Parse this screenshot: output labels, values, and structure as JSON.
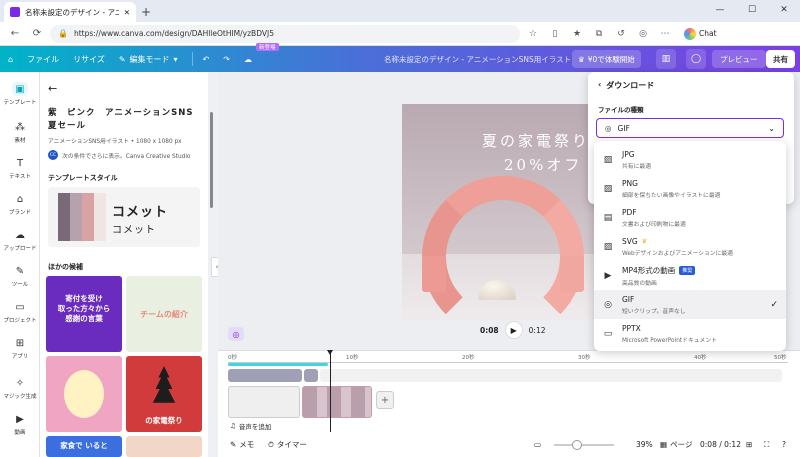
{
  "browser": {
    "tab_title": "名称未設定のデザイン - アニメーション",
    "url": "https://www.canva.com/design/DAHlleOtHIM/yzBDVJ5",
    "chat_label": "Chat"
  },
  "topbar": {
    "file": "ファイル",
    "resize": "リサイズ",
    "edit_mode": "編集モード",
    "new_badge": "新登場",
    "doc_title": "名称未設定のデザイン - アニメーションSNS用イラスト",
    "trial": "¥0で体験開始",
    "preview": "プレビュー",
    "share": "共有"
  },
  "rail": {
    "items": [
      {
        "label": "テンプレート"
      },
      {
        "label": "素材"
      },
      {
        "label": "テキスト"
      },
      {
        "label": "ブランド"
      },
      {
        "label": "アップロード"
      },
      {
        "label": "ツール"
      },
      {
        "label": "プロジェクト"
      },
      {
        "label": "アプリ"
      },
      {
        "label": "マジック生成"
      },
      {
        "label": "動画"
      }
    ]
  },
  "panel": {
    "title": "紫　ピンク　アニメーションSNS　夏セール",
    "meta": "アニメーションSNS用イラスト • 1080 x 1080 px",
    "author_initials": "CC",
    "author_line": "次の条件でさらに表示。Canva Creative Studio",
    "style_heading": "テンプレートスタイル",
    "font_sample_1": "コメット",
    "font_sample_2": "コメット",
    "swatch_colors": [
      "#7a6a78",
      "#b5a2ad",
      "#d9a3a3",
      "#efe5e3"
    ],
    "other_heading": "ほかの候補",
    "thumbs": [
      {
        "text": "寄付を受け\n取った方々から\n感謝の言葉"
      },
      {
        "text": "チームの紹介"
      },
      {
        "text": ""
      },
      {
        "text": "の家電祭り"
      },
      {
        "text": "家食で いると"
      }
    ]
  },
  "canvas": {
    "art_line1": "夏の家電祭り",
    "art_line2": "20%オフ",
    "current_time": "0:08",
    "total_time": "0:12"
  },
  "timeline": {
    "ticks": [
      "0秒",
      "10秒",
      "20秒",
      "30秒",
      "40秒",
      "50秒"
    ],
    "add_audio": "音声を追加"
  },
  "bottombar": {
    "memo": "メモ",
    "timer": "タイマー",
    "zoom": "39%",
    "page": "ページ",
    "time": "0:08 / 0:12"
  },
  "download": {
    "heading": "ダウンロード",
    "file_type_label": "ファイルの種類",
    "selected": "GIF",
    "options": [
      {
        "name": "JPG",
        "desc": "共有に最適",
        "icon": "image-icon"
      },
      {
        "name": "PNG",
        "desc": "細部を保ちたい画像やイラストに最適",
        "icon": "image-icon"
      },
      {
        "name": "PDF",
        "desc": "文書および印刷物に最適",
        "icon": "document-icon"
      },
      {
        "name": "SVG",
        "desc": "Webデザインおよびアニメーションに最適",
        "icon": "image-icon"
      },
      {
        "name": "MP4形式の動画",
        "badge": "推奨",
        "desc": "高品質の動画",
        "icon": "video-icon"
      },
      {
        "name": "GIF",
        "desc": "短いクリップ。音声なし",
        "icon": "gif-icon"
      },
      {
        "name": "PPTX",
        "desc": "Microsoft PowerPointドキュメント",
        "icon": "presentation-icon"
      }
    ]
  },
  "colors": {
    "accent": "#7d2ae8",
    "topbar_start": "#00b4c8",
    "topbar_end": "#7b3fe4"
  }
}
